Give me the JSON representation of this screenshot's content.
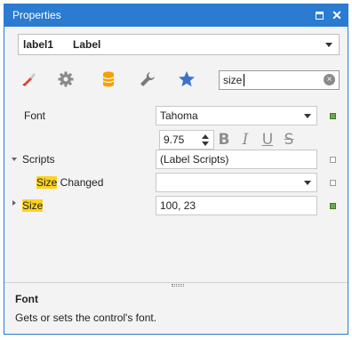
{
  "window": {
    "title": "Properties",
    "maximize_glyph": "",
    "close_glyph": "✕"
  },
  "object_selector": {
    "name": "label1",
    "type": "Label"
  },
  "tabs": [
    {
      "icon": "brush-icon",
      "color": "#e0423b"
    },
    {
      "icon": "gear-icon",
      "color": "#8a8a8a"
    },
    {
      "icon": "database-icon",
      "color": "#f5a100"
    },
    {
      "icon": "wrench-icon",
      "color": "#7a7a7a"
    },
    {
      "icon": "star-icon",
      "color": "#3b73c8"
    }
  ],
  "search": {
    "value": "size",
    "clear_glyph": "×"
  },
  "properties": {
    "font": {
      "label": "Font",
      "value": "Tahoma",
      "size": "9.75",
      "bold": "B",
      "italic": "I",
      "underline": "U",
      "strikeout": "S"
    },
    "scripts": {
      "label": "Scripts",
      "value": "(Label Scripts)"
    },
    "size_changed": {
      "label_highlight": "Size",
      "label_rest": " Changed",
      "value": ""
    },
    "size": {
      "label": "Size",
      "value": "100, 23"
    }
  },
  "description": {
    "title": "Font",
    "text": "Gets or sets the control's font."
  },
  "colors": {
    "accent": "#2b7bd0",
    "highlight": "#ffd21f",
    "modified_marker": "#6aa84f"
  }
}
